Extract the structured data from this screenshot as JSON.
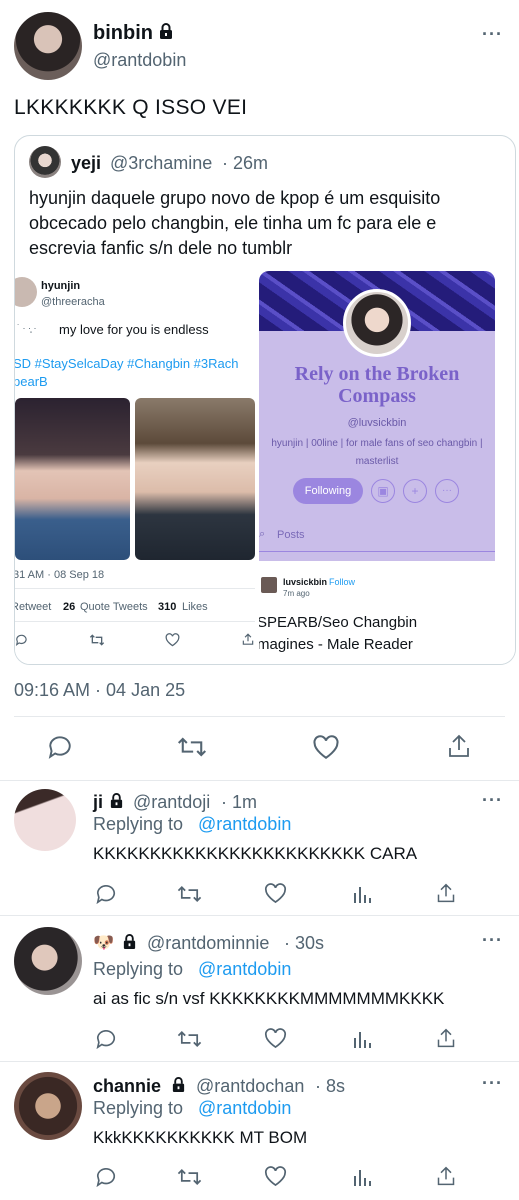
{
  "main_tweet": {
    "display_name": "binbin",
    "handle": "@rantdobin",
    "text": "LKKKKKKK Q ISSO VEI",
    "timestamp": "09:16 AM · 04 Jan 25"
  },
  "quoted": {
    "display_name": "yeji",
    "handle": "@3rchamine",
    "time": "· 26m",
    "text_lines": [
      "hyunjin daquele grupo novo de kpop é um esquisito",
      "obcecado pelo changbin, ele tinha um fc para ele e",
      "escrevia fanfic s/n dele no tumblr"
    ],
    "left_image": {
      "name": "hyunjin",
      "handle": "@threeracha",
      "text": "my love for you is endless",
      "hashtags": "SD #StaySelcaDay #Changbin #3Rach",
      "hashtags2": "pearB",
      "time": "31 AM · 08 Sep 18",
      "stats_retweet": "Retweet",
      "quote_count": "26",
      "quote_label": "Quote Tweets",
      "likes_count": "310",
      "likes_label": "Likes"
    },
    "right_image": {
      "blog_title_1": "Rely on the Broken",
      "blog_title_2": "Compass",
      "blog_handle": "@luvsickbin",
      "blog_desc_1": "hyunjin | 00line | for male fans of seo changbin |",
      "blog_desc_2": "masterlist",
      "following": "Following",
      "posts_tab": "Posts",
      "poster": "luvsickbin",
      "follow": "Follow",
      "post_time": "7m ago",
      "post_title_1": "SPEARB/Seo Changbin",
      "post_title_2": "magines - Male Reader"
    }
  },
  "replies": [
    {
      "display_name": "ji",
      "handle": "@rantdoji",
      "time": "· 1m",
      "replying_prefix": "Replying to",
      "replying_handle": "@rantdobin",
      "text": "KKKKKKKKKKKKKKKKKKKKKKKK CARA"
    },
    {
      "display_name": "🐶",
      "handle": "@rantdominnie",
      "time": "· 30s",
      "replying_prefix": "Replying to",
      "replying_handle": "@rantdobin",
      "text": "ai as fic s/n vsf KKKKKKKKMMMMMMMKKKK"
    },
    {
      "display_name": "channie",
      "handle": "@rantdochan",
      "time": "· 8s",
      "replying_prefix": "Replying to",
      "replying_handle": "@rantdobin",
      "text": "KkkKKKKKKKKKK MT BOM"
    }
  ],
  "colors": {
    "accent": "#1d9bf0",
    "muted": "#536471",
    "blog_bg": "#c9bde9",
    "blog_title": "#7a62c9"
  }
}
